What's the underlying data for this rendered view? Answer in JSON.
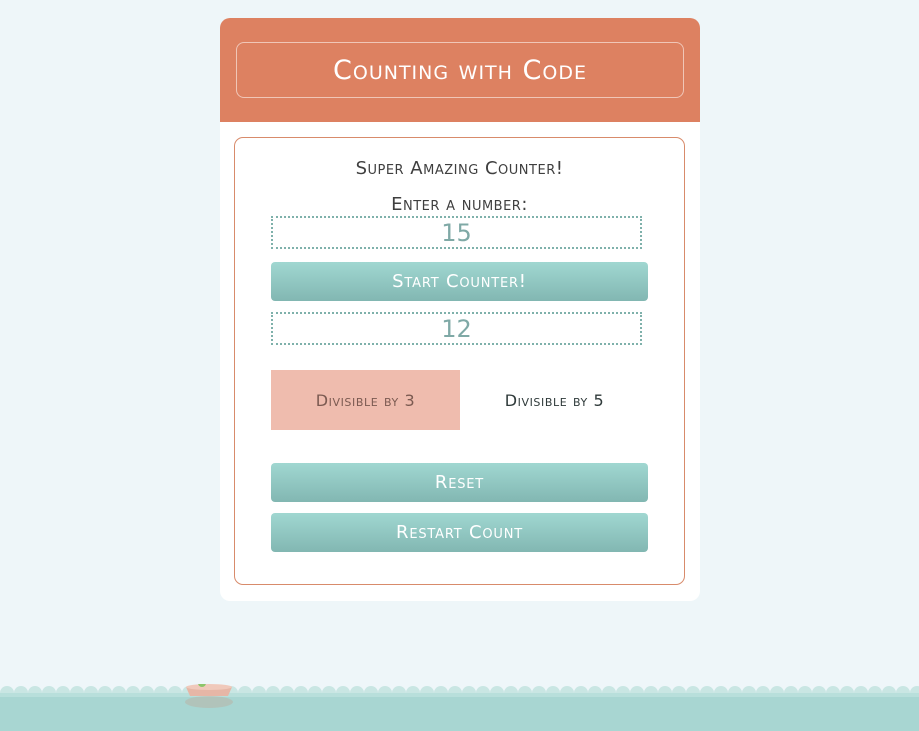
{
  "header": {
    "title": "Counting with Code"
  },
  "main": {
    "subtitle": "Super Amazing Counter!",
    "prompt": "Enter a number:",
    "number_input": {
      "value": "15"
    },
    "start_button": "Start Counter!",
    "counter_display": "12",
    "badges": {
      "div3": {
        "label": "Divisible by 3",
        "active": true
      },
      "div5": {
        "label": "Divisible by 5",
        "active": false
      }
    },
    "reset_button": "Reset",
    "restart_button": "Restart Count"
  },
  "colors": {
    "background": "#eef6f9",
    "header": "#dd8161",
    "accent_teal": "#93c9c3",
    "badge_active": "#efbcae",
    "water": "#a8d6d2"
  }
}
